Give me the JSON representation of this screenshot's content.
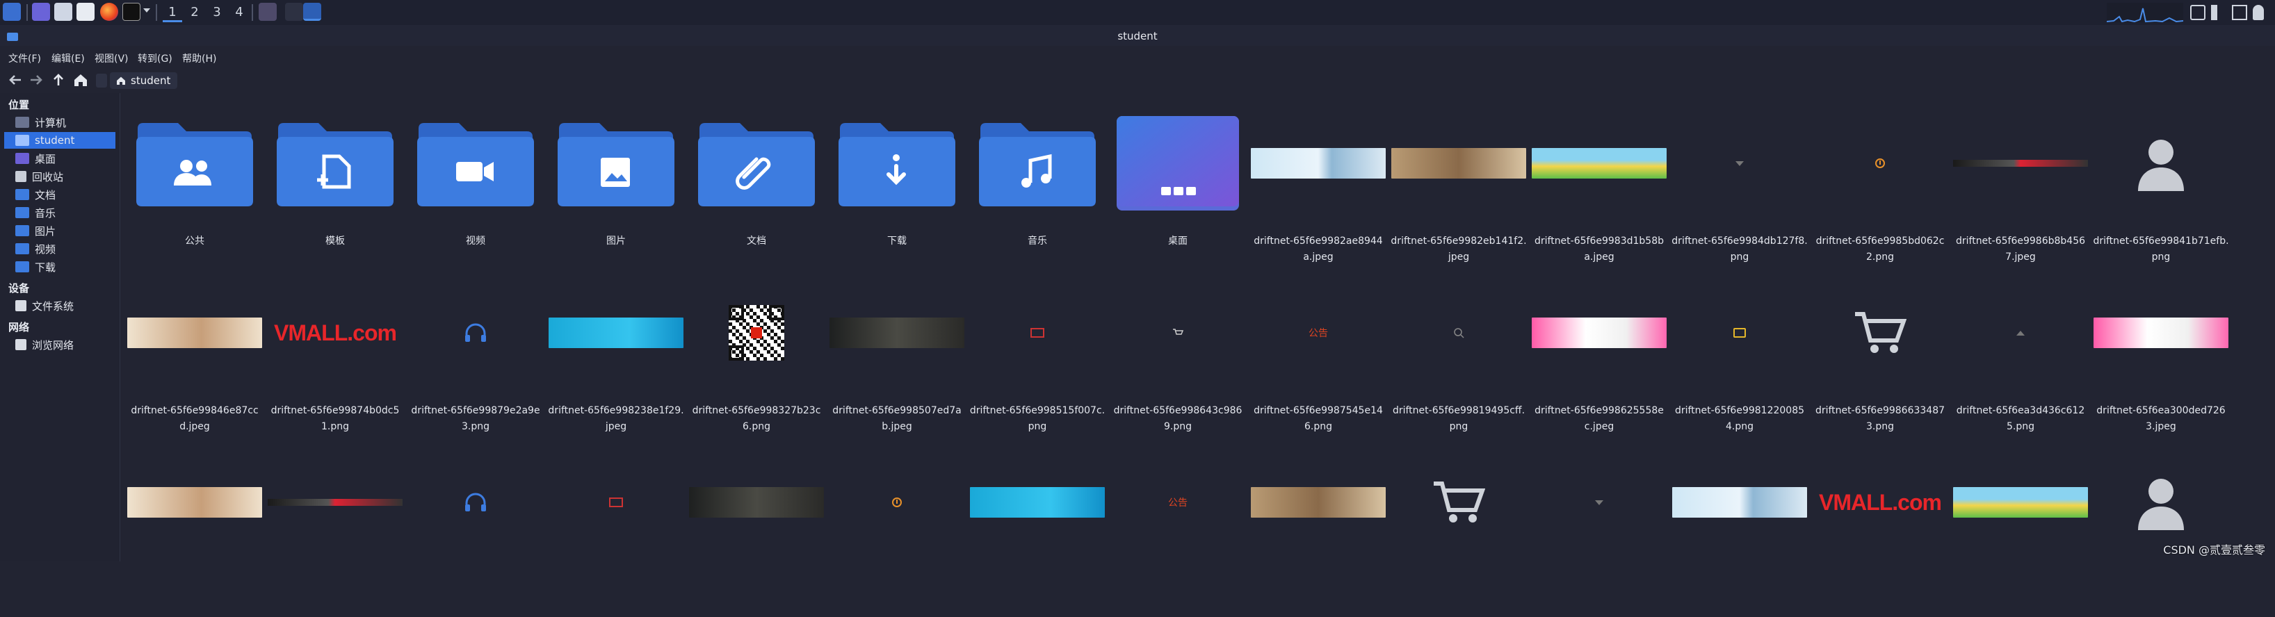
{
  "window": {
    "title": "student"
  },
  "taskbar": {
    "workspaces": [
      "1",
      "2",
      "3",
      "4"
    ]
  },
  "menubar": {
    "items": [
      "文件(F)",
      "编辑(E)",
      "视图(V)",
      "转到(G)",
      "帮助(H)"
    ]
  },
  "location": {
    "current": "student"
  },
  "sidebar": {
    "sections": [
      {
        "heading": "位置",
        "items": [
          "计算机",
          "student",
          "桌面",
          "回收站",
          "文档",
          "音乐",
          "图片",
          "视频",
          "下载"
        ]
      },
      {
        "heading": "设备",
        "items": [
          "文件系统"
        ]
      },
      {
        "heading": "网络",
        "items": [
          "浏览网络"
        ]
      }
    ]
  },
  "files": [
    {
      "name": "公共",
      "kind": "folder",
      "icon": "users-icon"
    },
    {
      "name": "模板",
      "kind": "folder",
      "icon": "template-icon"
    },
    {
      "name": "视频",
      "kind": "folder",
      "icon": "video-icon"
    },
    {
      "name": "图片",
      "kind": "folder",
      "icon": "image-icon"
    },
    {
      "name": "文档",
      "kind": "folder",
      "icon": "paperclip-icon"
    },
    {
      "name": "下载",
      "kind": "folder",
      "icon": "download-icon"
    },
    {
      "name": "音乐",
      "kind": "folder",
      "icon": "music-icon"
    },
    {
      "name": "桌面",
      "kind": "desktop-folder",
      "icon": "desktop-icon"
    },
    {
      "name": "driftnet-65f6e9982ae8944a.jpeg",
      "kind": "banner-light-blue"
    },
    {
      "name": "driftnet-65f6e9982eb141f2.jpeg",
      "kind": "banner-tan"
    },
    {
      "name": "driftnet-65f6e9983d1b58ba.jpeg",
      "kind": "banner-green-yellow"
    },
    {
      "name": "driftnet-65f6e9984db127f8.png",
      "kind": "small-arrow"
    },
    {
      "name": "driftnet-65f6e9985bd062c2.png",
      "kind": "small-orange"
    },
    {
      "name": "driftnet-65f6e9986b8b4567.jpeg",
      "kind": "banner-dark-strip"
    },
    {
      "name": "driftnet-65f6e99841b71efb.png",
      "kind": "person-placeholder"
    },
    {
      "name": "driftnet-65f6e99846e87ccd.jpeg",
      "kind": "banner-beige"
    },
    {
      "name": "driftnet-65f6e99874b0dc51.png",
      "kind": "vmall-logo",
      "text": "VMALL.com"
    },
    {
      "name": "driftnet-65f6e99879e2a9e3.png",
      "kind": "headphones"
    },
    {
      "name": "driftnet-65f6e998238e1f29.jpeg",
      "kind": "banner-cyan"
    },
    {
      "name": "driftnet-65f6e998327b23c6.png",
      "kind": "qr-code"
    },
    {
      "name": "driftnet-65f6e998507ed7ab.jpeg",
      "kind": "banner-dark-person"
    },
    {
      "name": "driftnet-65f6e998515f007c.png",
      "kind": "small-red-box"
    },
    {
      "name": "driftnet-65f6e998643c9869.png",
      "kind": "small-cart"
    },
    {
      "name": "driftnet-65f6e9987545e146.png",
      "kind": "red-text",
      "text": "公告"
    },
    {
      "name": "driftnet-65f6e99819495cff.png",
      "kind": "small-search"
    },
    {
      "name": "driftnet-65f6e998625558ec.jpeg",
      "kind": "banner-pink"
    },
    {
      "name": "driftnet-65f6e99812200854.png",
      "kind": "small-yellow-card"
    },
    {
      "name": "driftnet-65f6e99866334873.png",
      "kind": "cart"
    },
    {
      "name": "driftnet-65f6ea3d436c6125.png",
      "kind": "small-up-arrow"
    },
    {
      "name": "driftnet-65f6ea300ded7263.jpeg",
      "kind": "banner-pink"
    },
    {
      "name": "",
      "kind": "banner-beige"
    },
    {
      "name": "",
      "kind": "banner-dark-strip"
    },
    {
      "name": "",
      "kind": "headphones"
    },
    {
      "name": "",
      "kind": "small-red-box"
    },
    {
      "name": "",
      "kind": "banner-dark-person"
    },
    {
      "name": "",
      "kind": "small-orange"
    },
    {
      "name": "",
      "kind": "banner-cyan"
    },
    {
      "name": "",
      "kind": "red-text",
      "text": "公告"
    },
    {
      "name": "",
      "kind": "banner-tan"
    },
    {
      "name": "",
      "kind": "cart"
    },
    {
      "name": "",
      "kind": "small-arrow"
    },
    {
      "name": "",
      "kind": "banner-light-blue"
    },
    {
      "name": "",
      "kind": "vmall-logo",
      "text": "VMALL.com"
    },
    {
      "name": "",
      "kind": "banner-green-yellow"
    },
    {
      "name": "",
      "kind": "person-placeholder"
    }
  ],
  "watermark": "CSDN @贰壹贰叁零",
  "colors": {
    "accent": "#2f6fe0",
    "folder": "#3d7ce0",
    "folderTab": "#2f66c8",
    "bg": "#222432"
  }
}
